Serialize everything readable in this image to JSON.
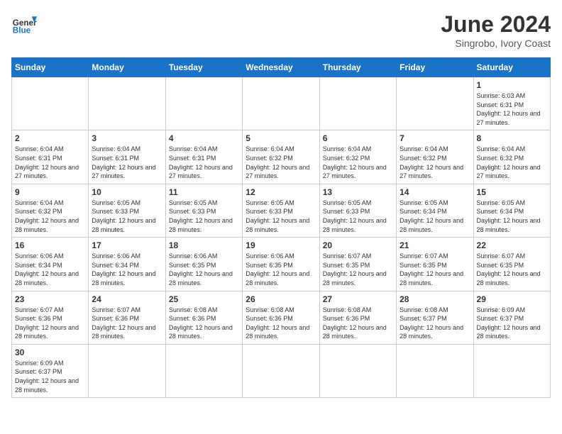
{
  "header": {
    "logo_general": "General",
    "logo_blue": "Blue",
    "month_year": "June 2024",
    "location": "Singrobo, Ivory Coast"
  },
  "weekdays": [
    "Sunday",
    "Monday",
    "Tuesday",
    "Wednesday",
    "Thursday",
    "Friday",
    "Saturday"
  ],
  "weeks": [
    [
      {
        "day": "",
        "info": ""
      },
      {
        "day": "",
        "info": ""
      },
      {
        "day": "",
        "info": ""
      },
      {
        "day": "",
        "info": ""
      },
      {
        "day": "",
        "info": ""
      },
      {
        "day": "",
        "info": ""
      },
      {
        "day": "1",
        "info": "Sunrise: 6:03 AM\nSunset: 6:31 PM\nDaylight: 12 hours and 27 minutes."
      }
    ],
    [
      {
        "day": "2",
        "info": "Sunrise: 6:04 AM\nSunset: 6:31 PM\nDaylight: 12 hours and 27 minutes."
      },
      {
        "day": "3",
        "info": "Sunrise: 6:04 AM\nSunset: 6:31 PM\nDaylight: 12 hours and 27 minutes."
      },
      {
        "day": "4",
        "info": "Sunrise: 6:04 AM\nSunset: 6:31 PM\nDaylight: 12 hours and 27 minutes."
      },
      {
        "day": "5",
        "info": "Sunrise: 6:04 AM\nSunset: 6:32 PM\nDaylight: 12 hours and 27 minutes."
      },
      {
        "day": "6",
        "info": "Sunrise: 6:04 AM\nSunset: 6:32 PM\nDaylight: 12 hours and 27 minutes."
      },
      {
        "day": "7",
        "info": "Sunrise: 6:04 AM\nSunset: 6:32 PM\nDaylight: 12 hours and 27 minutes."
      },
      {
        "day": "8",
        "info": "Sunrise: 6:04 AM\nSunset: 6:32 PM\nDaylight: 12 hours and 27 minutes."
      }
    ],
    [
      {
        "day": "9",
        "info": "Sunrise: 6:04 AM\nSunset: 6:32 PM\nDaylight: 12 hours and 28 minutes."
      },
      {
        "day": "10",
        "info": "Sunrise: 6:05 AM\nSunset: 6:33 PM\nDaylight: 12 hours and 28 minutes."
      },
      {
        "day": "11",
        "info": "Sunrise: 6:05 AM\nSunset: 6:33 PM\nDaylight: 12 hours and 28 minutes."
      },
      {
        "day": "12",
        "info": "Sunrise: 6:05 AM\nSunset: 6:33 PM\nDaylight: 12 hours and 28 minutes."
      },
      {
        "day": "13",
        "info": "Sunrise: 6:05 AM\nSunset: 6:33 PM\nDaylight: 12 hours and 28 minutes."
      },
      {
        "day": "14",
        "info": "Sunrise: 6:05 AM\nSunset: 6:34 PM\nDaylight: 12 hours and 28 minutes."
      },
      {
        "day": "15",
        "info": "Sunrise: 6:05 AM\nSunset: 6:34 PM\nDaylight: 12 hours and 28 minutes."
      }
    ],
    [
      {
        "day": "16",
        "info": "Sunrise: 6:06 AM\nSunset: 6:34 PM\nDaylight: 12 hours and 28 minutes."
      },
      {
        "day": "17",
        "info": "Sunrise: 6:06 AM\nSunset: 6:34 PM\nDaylight: 12 hours and 28 minutes."
      },
      {
        "day": "18",
        "info": "Sunrise: 6:06 AM\nSunset: 6:35 PM\nDaylight: 12 hours and 28 minutes."
      },
      {
        "day": "19",
        "info": "Sunrise: 6:06 AM\nSunset: 6:35 PM\nDaylight: 12 hours and 28 minutes."
      },
      {
        "day": "20",
        "info": "Sunrise: 6:07 AM\nSunset: 6:35 PM\nDaylight: 12 hours and 28 minutes."
      },
      {
        "day": "21",
        "info": "Sunrise: 6:07 AM\nSunset: 6:35 PM\nDaylight: 12 hours and 28 minutes."
      },
      {
        "day": "22",
        "info": "Sunrise: 6:07 AM\nSunset: 6:35 PM\nDaylight: 12 hours and 28 minutes."
      }
    ],
    [
      {
        "day": "23",
        "info": "Sunrise: 6:07 AM\nSunset: 6:36 PM\nDaylight: 12 hours and 28 minutes."
      },
      {
        "day": "24",
        "info": "Sunrise: 6:07 AM\nSunset: 6:36 PM\nDaylight: 12 hours and 28 minutes."
      },
      {
        "day": "25",
        "info": "Sunrise: 6:08 AM\nSunset: 6:36 PM\nDaylight: 12 hours and 28 minutes."
      },
      {
        "day": "26",
        "info": "Sunrise: 6:08 AM\nSunset: 6:36 PM\nDaylight: 12 hours and 28 minutes."
      },
      {
        "day": "27",
        "info": "Sunrise: 6:08 AM\nSunset: 6:36 PM\nDaylight: 12 hours and 28 minutes."
      },
      {
        "day": "28",
        "info": "Sunrise: 6:08 AM\nSunset: 6:37 PM\nDaylight: 12 hours and 28 minutes."
      },
      {
        "day": "29",
        "info": "Sunrise: 6:09 AM\nSunset: 6:37 PM\nDaylight: 12 hours and 28 minutes."
      }
    ],
    [
      {
        "day": "30",
        "info": "Sunrise: 6:09 AM\nSunset: 6:37 PM\nDaylight: 12 hours and 28 minutes."
      },
      {
        "day": "",
        "info": ""
      },
      {
        "day": "",
        "info": ""
      },
      {
        "day": "",
        "info": ""
      },
      {
        "day": "",
        "info": ""
      },
      {
        "day": "",
        "info": ""
      },
      {
        "day": "",
        "info": ""
      }
    ]
  ]
}
